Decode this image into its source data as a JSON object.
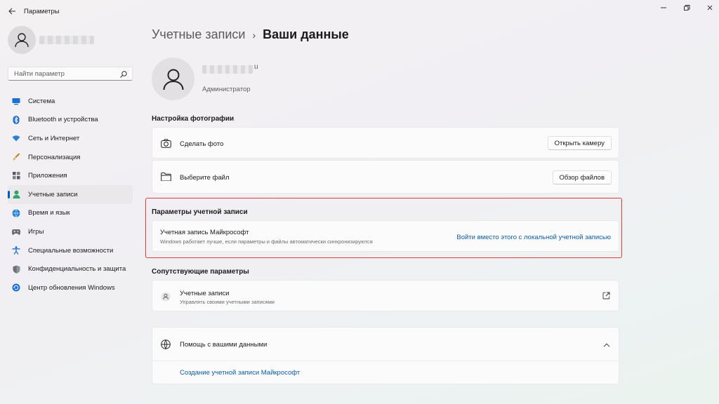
{
  "window": {
    "title": "Параметры"
  },
  "sidebar": {
    "search_placeholder": "Найти параметр",
    "items": [
      {
        "label": "Система",
        "icon": "monitor-icon",
        "color": "#1f6fd1"
      },
      {
        "label": "Bluetooth и устройства",
        "icon": "bluetooth-icon",
        "color": "#1f6fd1"
      },
      {
        "label": "Сеть и Интернет",
        "icon": "wifi-icon",
        "color": "#2a7fd4"
      },
      {
        "label": "Персонализация",
        "icon": "brush-icon",
        "color": "#d9822b"
      },
      {
        "label": "Приложения",
        "icon": "apps-icon",
        "color": "#555b66"
      },
      {
        "label": "Учетные записи",
        "icon": "person-icon",
        "color": "#2fa36b"
      },
      {
        "label": "Время и язык",
        "icon": "globe-clock-icon",
        "color": "#1f7dd1"
      },
      {
        "label": "Игры",
        "icon": "gamepad-icon",
        "color": "#6b6b6b"
      },
      {
        "label": "Специальные возможности",
        "icon": "accessibility-icon",
        "color": "#1f6fd1"
      },
      {
        "label": "Конфиденциальность и защита",
        "icon": "shield-icon",
        "color": "#6b6f78"
      },
      {
        "label": "Центр обновления Windows",
        "icon": "update-icon",
        "color": "#1f6fd1"
      }
    ],
    "active_index": 5
  },
  "breadcrumb": {
    "parent": "Учетные записи",
    "separator": "›",
    "current": "Ваши данные"
  },
  "user": {
    "name_suffix": "u",
    "role": "Администратор"
  },
  "photo_section": {
    "title": "Настройка фотографии",
    "rows": [
      {
        "label": "Сделать фото",
        "button": "Открыть камеру",
        "icon": "camera-icon"
      },
      {
        "label": "Выберите файл",
        "button": "Обзор файлов",
        "icon": "folder-icon"
      }
    ]
  },
  "account_section": {
    "title": "Параметры учетной записи",
    "row_title": "Учетная запись Майкрософт",
    "row_subtitle": "Windows работает лучше, если параметры и файлы автоматически синхронизируются",
    "link": "Войти вместо этого с локальной учетной записью"
  },
  "related_section": {
    "title": "Сопутствующие параметры",
    "row_title": "Учетные записи",
    "row_subtitle": "Управлять своими учетными записями"
  },
  "help_section": {
    "title": "Помощь с вашими данными",
    "link": "Создание учетной записи Майкрософт"
  },
  "accent": "#005fb8",
  "highlight_color": "#e23b3b"
}
